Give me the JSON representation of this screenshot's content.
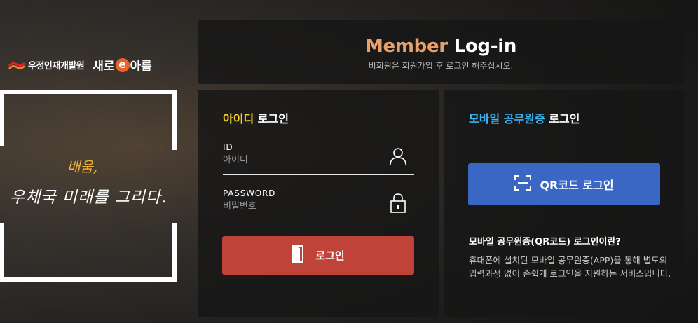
{
  "brand": {
    "org_name": "우정인재개발원",
    "service_name_pre": "새로",
    "service_name_mark": "e",
    "service_name_post": "아름",
    "slogan_line1": "배움,",
    "slogan_line2": "우체국 미래를 그리다."
  },
  "header": {
    "title_accent": "Member",
    "title_rest": "Log-in",
    "subtitle": "비회원은 회원가입 후 로그인 해주십시오."
  },
  "id_login": {
    "title_accent": "아이디",
    "title_rest": "로그인",
    "id_label": "ID",
    "id_placeholder": "아이디",
    "password_label": "PASSWORD",
    "password_placeholder": "비밀번호",
    "login_button": "로그인"
  },
  "mobile_login": {
    "title_accent": "모바일 공무원증",
    "title_rest": "로그인",
    "qr_button": "QR코드 로그인",
    "info_title": "모바일 공무원증(QR코드) 로그인이란?",
    "info_desc": "휴대폰에 설치된 모바일 공무원증(APP)을 통해 별도의 입력과정 없이 손쉽게 로그인을 지원하는 서비스입니다."
  },
  "colors": {
    "member_accent": "#e8a06b",
    "id_accent": "#f7d12a",
    "mobile_accent": "#3bb2f0",
    "login_button": "#c0433a",
    "qr_button": "#3a66c4"
  },
  "icons": {
    "user": "user-icon",
    "lock": "lock-icon",
    "door": "door-icon",
    "qr_scan": "qr-scan-icon",
    "post_logo": "korea-post-logo"
  }
}
